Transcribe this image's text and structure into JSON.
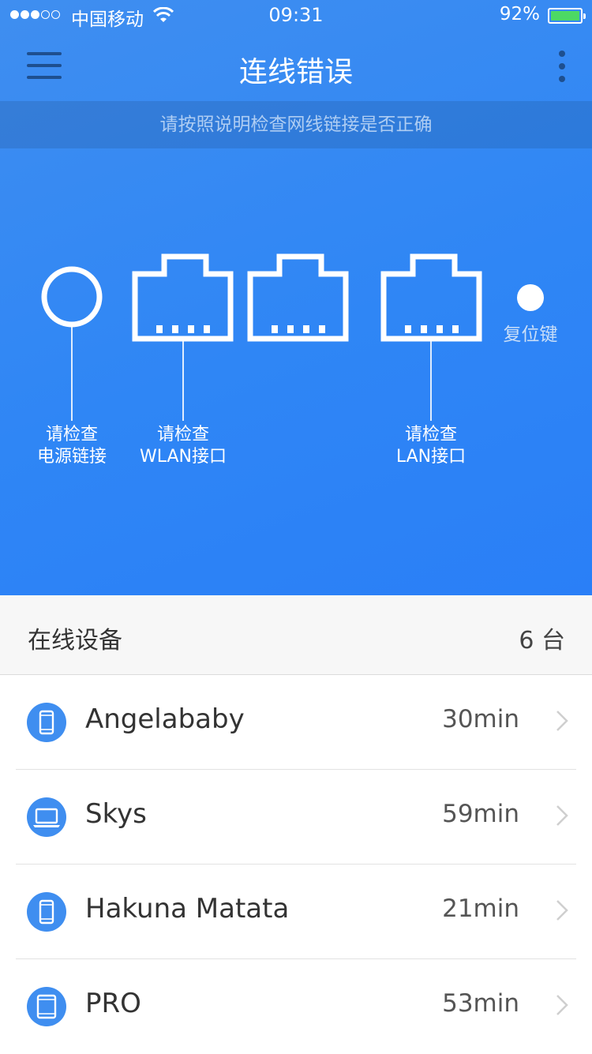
{
  "status_bar": {
    "carrier": "中国移动",
    "time": "09:31",
    "battery": "92%",
    "signal_bars_filled": 3,
    "signal_bars_total": 5
  },
  "nav": {
    "title": "连线错误",
    "menu_icon": "hamburger-icon",
    "more_icon": "more-vertical-icon"
  },
  "hint": "请按照说明检查网线链接是否正确",
  "ports": {
    "power_line1": "请检查",
    "power_line2": "电源链接",
    "wlan_line1": "请检查",
    "wlan_line2": "WLAN接口",
    "lan_line1": "请检查",
    "lan_line2": "LAN接口",
    "reset": "复位键"
  },
  "devices_section": {
    "title": "在线设备",
    "count": "6 台"
  },
  "devices": [
    {
      "name": "Angelababy",
      "duration": "30min",
      "icon": "phone-icon"
    },
    {
      "name": "Skys",
      "duration": "59min",
      "icon": "laptop-icon"
    },
    {
      "name": "Hakuna Matata",
      "duration": "21min",
      "icon": "phone-icon"
    },
    {
      "name": "PRO",
      "duration": "53min",
      "icon": "tablet-icon"
    }
  ],
  "colors": {
    "primary": "#2f86f5",
    "icon_bg": "#3f8ef0",
    "battery": "#4cd964"
  }
}
